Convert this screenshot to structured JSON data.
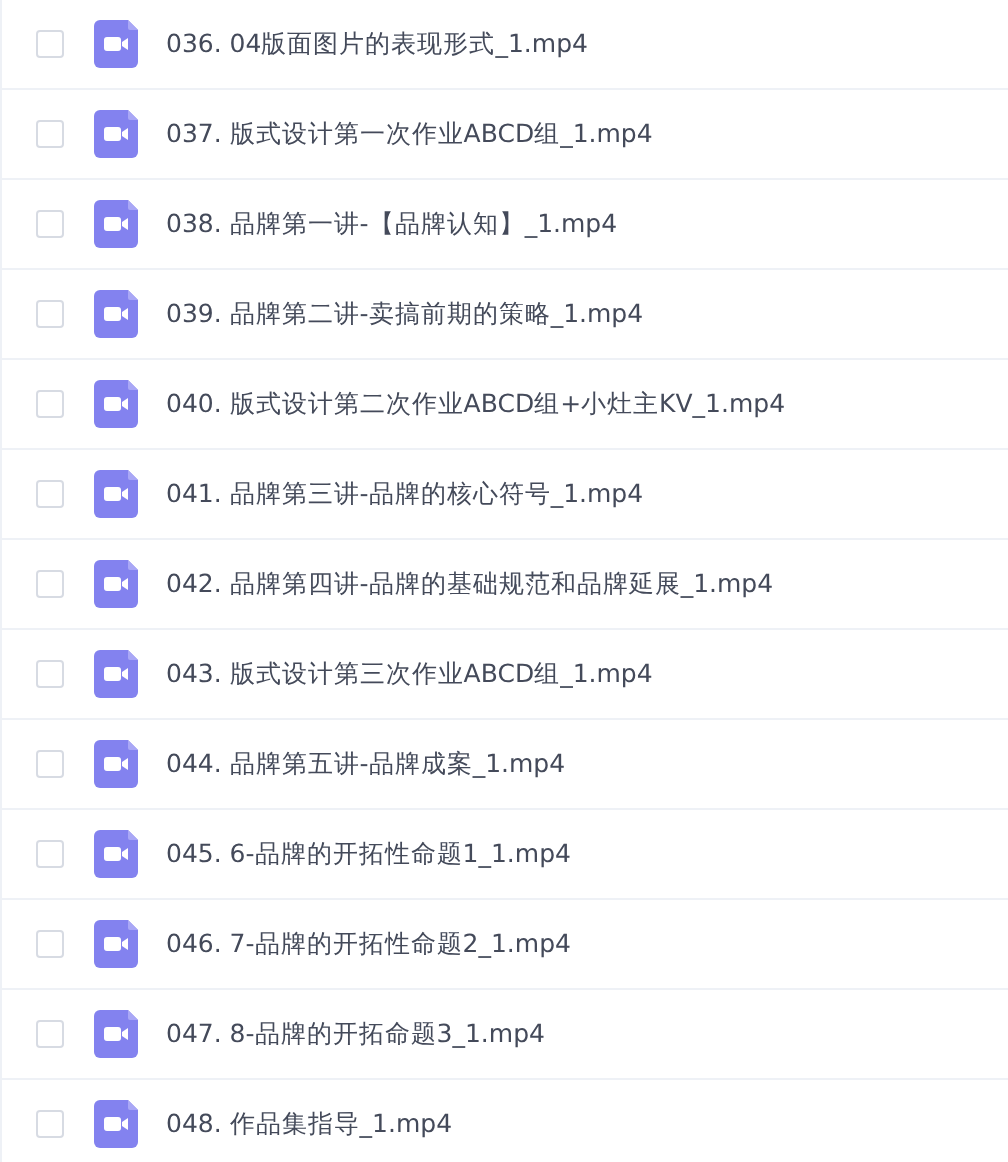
{
  "files": [
    {
      "name": "036. 04版面图片的表现形式_1.mp4",
      "checked": false
    },
    {
      "name": "037. 版式设计第一次作业ABCD组_1.mp4",
      "checked": false
    },
    {
      "name": "038. 品牌第一讲-【品牌认知】_1.mp4",
      "checked": false
    },
    {
      "name": "039. 品牌第二讲-卖搞前期的策略_1.mp4",
      "checked": false
    },
    {
      "name": "040. 版式设计第二次作业ABCD组+小灶主KV_1.mp4",
      "checked": false
    },
    {
      "name": "041. 品牌第三讲-品牌的核心符号_1.mp4",
      "checked": false
    },
    {
      "name": "042. 品牌第四讲-品牌的基础规范和品牌延展_1.mp4",
      "checked": false
    },
    {
      "name": "043. 版式设计第三次作业ABCD组_1.mp4",
      "checked": false
    },
    {
      "name": "044. 品牌第五讲-品牌成案_1.mp4",
      "checked": false
    },
    {
      "name": "045. 6-品牌的开拓性命题1_1.mp4",
      "checked": false
    },
    {
      "name": "046. 7-品牌的开拓性命题2_1.mp4",
      "checked": false
    },
    {
      "name": "047. 8-品牌的开拓命题3_1.mp4",
      "checked": false
    },
    {
      "name": "048. 作品集指导_1.mp4",
      "checked": false
    }
  ]
}
